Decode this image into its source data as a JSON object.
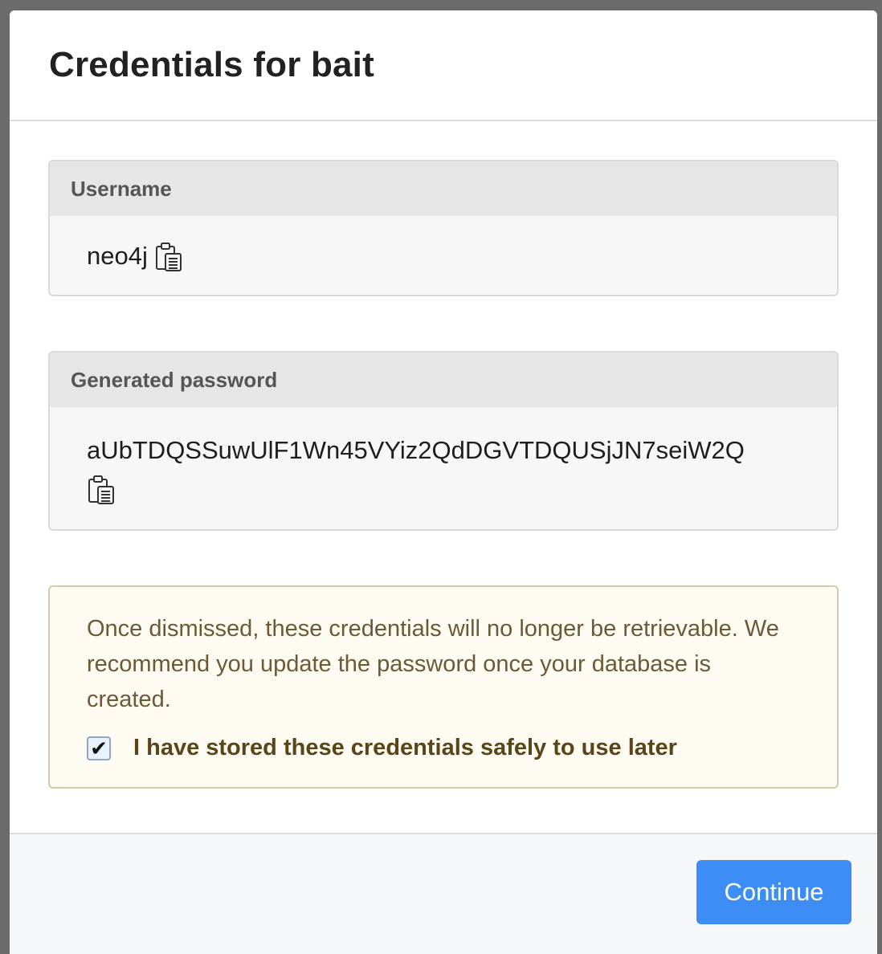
{
  "dialog": {
    "title": "Credentials for bait"
  },
  "username": {
    "label": "Username",
    "value": "neo4j",
    "copy_icon": "clipboard-icon"
  },
  "password": {
    "label": "Generated password",
    "value": "aUbTDQSSuwUlF1Wn45VYiz2QdDGVTDQUSjJN7seiW2Q",
    "copy_icon": "clipboard-icon"
  },
  "warning": {
    "message": "Once dismissed, these credentials will no longer be retrievable. We recommend you update the password once your database is created.",
    "checkbox_label": "I have stored these credentials safely to use later",
    "checkbox_checked": true
  },
  "footer": {
    "continue_label": "Continue"
  },
  "colors": {
    "primary_button": "#3d8df5",
    "warning_bg": "#fefbf2",
    "warning_border": "#d6c8a8",
    "label_bg": "#e6e6e6"
  }
}
